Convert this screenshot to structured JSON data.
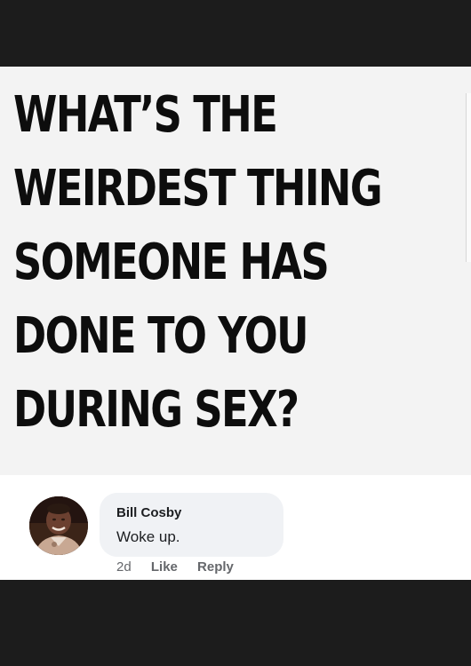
{
  "post": {
    "headline_lines": [
      "WHAT’S THE",
      "WEIRDEST THING",
      "SOMEONE HAS",
      "DONE TO YOU",
      "DURING SEX?"
    ]
  },
  "comment": {
    "author": "Bill Cosby",
    "text": "Woke up.",
    "timestamp": "2d",
    "like_label": "Like",
    "reply_label": "Reply",
    "avatar_icon": "profile-photo-icon"
  },
  "colors": {
    "background": "#1c1c1c",
    "card": "#ffffff",
    "bubble": "#f0f2f5",
    "meta_text": "#65676b"
  }
}
